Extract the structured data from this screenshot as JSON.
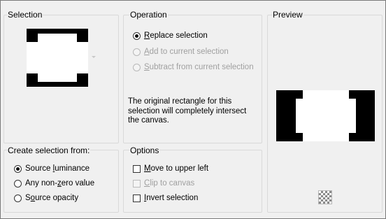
{
  "selection": {
    "title": "Selection"
  },
  "operation": {
    "title": "Operation",
    "options": [
      {
        "pre": "",
        "key": "R",
        "post": "eplace selection",
        "checked": true,
        "disabled": false
      },
      {
        "pre": "",
        "key": "A",
        "post": "dd to current selection",
        "checked": false,
        "disabled": true
      },
      {
        "pre": "",
        "key": "S",
        "post": "ubtract from current selection",
        "checked": false,
        "disabled": true
      }
    ],
    "info_line1": "The original rectangle for this",
    "info_line2": "selection will completely intersect",
    "info_line3": "the canvas."
  },
  "preview": {
    "title": "Preview",
    "background_icon": "checkerboard-icon"
  },
  "create_from": {
    "title": "Create selection from:",
    "options": [
      {
        "pre": "Source ",
        "key": "l",
        "post": "uminance",
        "checked": true
      },
      {
        "pre": "Any non-",
        "key": "z",
        "post": "ero value",
        "checked": false
      },
      {
        "pre": "S",
        "key": "o",
        "post": "urce opacity",
        "checked": false
      }
    ]
  },
  "options": {
    "title": "Options",
    "items": [
      {
        "pre": "",
        "key": "M",
        "post": "ove to upper left",
        "checked": false,
        "disabled": false
      },
      {
        "pre": "",
        "key": "C",
        "post": "lip to canvas",
        "checked": false,
        "disabled": true
      },
      {
        "pre": "",
        "key": "I",
        "post": "nvert selection",
        "checked": false,
        "disabled": false
      }
    ]
  }
}
